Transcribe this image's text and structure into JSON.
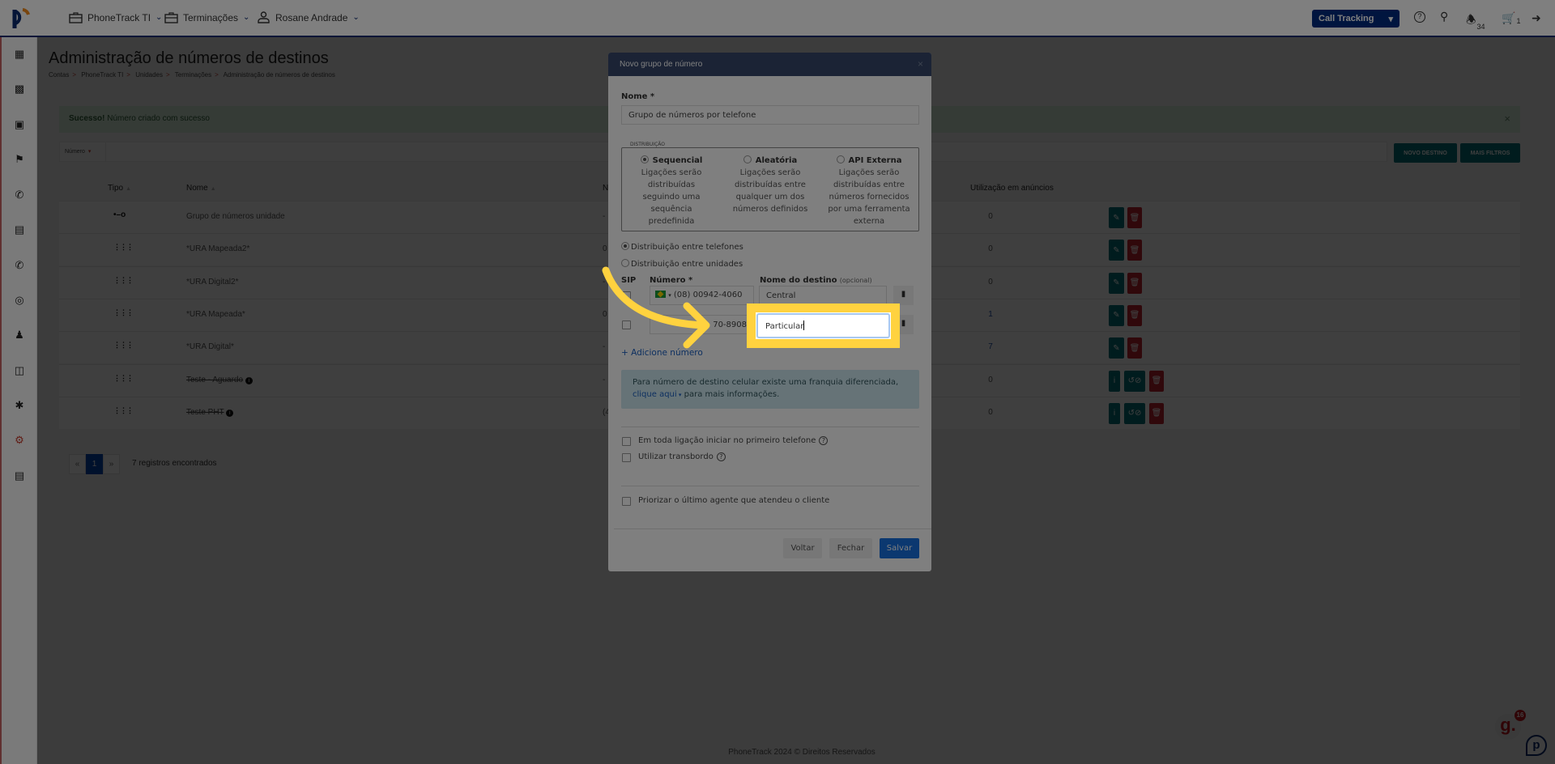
{
  "header": {
    "nav": [
      {
        "label": "PhoneTrack TI",
        "icon": "briefcase-icon"
      },
      {
        "label": "Terminações",
        "icon": "briefcase-icon"
      },
      {
        "label": "Rosane Andrade",
        "icon": "user-icon"
      }
    ],
    "product_select": "Call Tracking",
    "notifications_count": "34",
    "cart_count": "1"
  },
  "page": {
    "title": "Administração de números de destinos",
    "breadcrumb": [
      "Contas",
      "PhoneTrack TI",
      "Unidades",
      "Terminações",
      "Administração de números de destinos"
    ],
    "alert": {
      "strong": "Sucesso!",
      "text": " Número criado com sucesso",
      "close": "×"
    },
    "filter_label": "Número",
    "buttons": {
      "new": "NOVO DESTINO",
      "filters": "MAIS FILTROS"
    },
    "table": {
      "headers": {
        "type": "Tipo",
        "name": "Nome",
        "number": "N",
        "usage": "Utilização em anúncios"
      },
      "rows": [
        {
          "type": "group",
          "name": "Grupo de números unidade",
          "number": "-",
          "usage": "0",
          "strike": false,
          "link": false,
          "actions": "edit"
        },
        {
          "type": "ivr",
          "name": "*URA Mapeada2*",
          "number": "0",
          "usage": "0",
          "strike": false,
          "link": false,
          "actions": "edit"
        },
        {
          "type": "ivr",
          "name": "*URA Digital2*",
          "number": "-",
          "usage": "0",
          "strike": false,
          "link": false,
          "actions": "edit"
        },
        {
          "type": "ivr",
          "name": "*URA Mapeada*",
          "number": "0",
          "usage": "1",
          "strike": false,
          "link": true,
          "actions": "edit"
        },
        {
          "type": "ivr",
          "name": "*URA Digital*",
          "number": "-",
          "usage": "7",
          "strike": false,
          "link": true,
          "actions": "edit"
        },
        {
          "type": "ivr",
          "name": "Teste - Aguardo",
          "number": "-",
          "usage": "0",
          "strike": true,
          "link": false,
          "actions": "info"
        },
        {
          "type": "ivr",
          "name": "Teste PHT",
          "number": "(4",
          "usage": "0",
          "strike": true,
          "link": false,
          "actions": "info"
        }
      ]
    },
    "pagination": {
      "prev": "«",
      "current": "1",
      "next": "»",
      "summary": "7 registros encontrados"
    },
    "footer": "PhoneTrack 2024 © Direitos Reservados"
  },
  "modal": {
    "title": "Novo grupo de número",
    "close": "×",
    "name_label": "Nome *",
    "name_value": "Grupo de números por telefone",
    "distribution": {
      "legend": "DISTRIBUIÇÃO",
      "options": [
        {
          "title": "Sequencial",
          "desc": "Ligações serão\ndistribuídas\nseguindo uma\nsequência\npredefinida",
          "selected": true
        },
        {
          "title": "Aleatória",
          "desc": "Ligações serão\ndistribuídas entre\nqualquer um dos\nnúmeros definidos",
          "selected": false
        },
        {
          "title": "API Externa",
          "desc": "Ligações serão\ndistribuídas entre\nnúmeros fornecidos\npor uma ferramenta\nexterna",
          "selected": false
        }
      ]
    },
    "mode_options": [
      {
        "label": "Distribuição entre telefones",
        "selected": true
      },
      {
        "label": "Distribuição entre unidades",
        "selected": false
      }
    ],
    "columns": {
      "sip": "SIP",
      "number": "Número *",
      "dest": "Nome do destino",
      "dest_hint": "(opcional)"
    },
    "rows": [
      {
        "number": "(08) 00942-4060",
        "dest": "Central"
      },
      {
        "number": "70-8908",
        "dest": "Particular"
      }
    ],
    "add_number": "+ Adicione número",
    "info": {
      "text": "Para número de destino celular existe uma franquia diferenciada,",
      "link": "clique aqui",
      "after": " para mais informações."
    },
    "checks": [
      {
        "label": "Em toda ligação iniciar no primeiro telefone",
        "help": true
      },
      {
        "label": "Utilizar transbordo",
        "help": true
      },
      {
        "label": "Priorizar o último agente que atendeu o cliente",
        "help": false
      }
    ],
    "buttons": {
      "back": "Voltar",
      "close": "Fechar",
      "save": "Salvar"
    }
  },
  "widgets": {
    "chat_badge": "16"
  },
  "colors": {
    "accent": "#002a7f",
    "teal": "#00737a",
    "danger": "#c0232f",
    "highlight": "#ffd23f"
  }
}
